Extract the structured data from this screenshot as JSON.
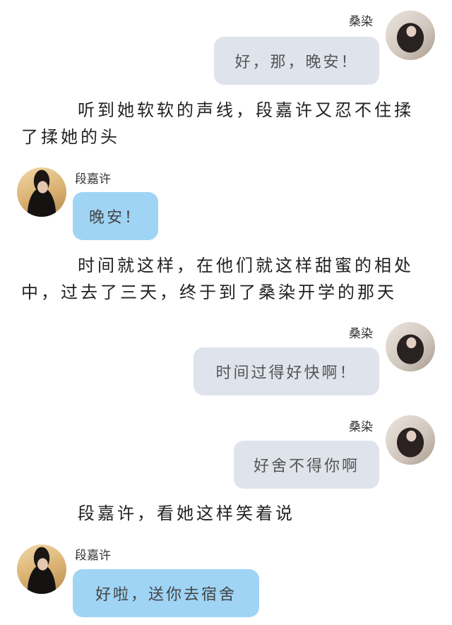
{
  "messages": [
    {
      "speaker": "桑染",
      "text": "好，那，晚安！"
    },
    {
      "speaker": "段嘉许",
      "text": "晚安！"
    },
    {
      "speaker": "桑染",
      "text": "时间过得好快啊！"
    },
    {
      "speaker": "桑染",
      "text": "好舍不得你啊"
    },
    {
      "speaker": "段嘉许",
      "text": "好啦，送你去宿舍"
    }
  ],
  "narration": [
    "听到她软软的声线，段嘉许又忍不住揉了揉她的头",
    "时间就这样，在他们就这样甜蜜的相处中，过去了三天，终于到了桑染开学的那天",
    "段嘉许，看她这样笑着说"
  ],
  "colors": {
    "right_bubble": "#dfe4ec",
    "left_bubble": "#9fd4f5"
  }
}
